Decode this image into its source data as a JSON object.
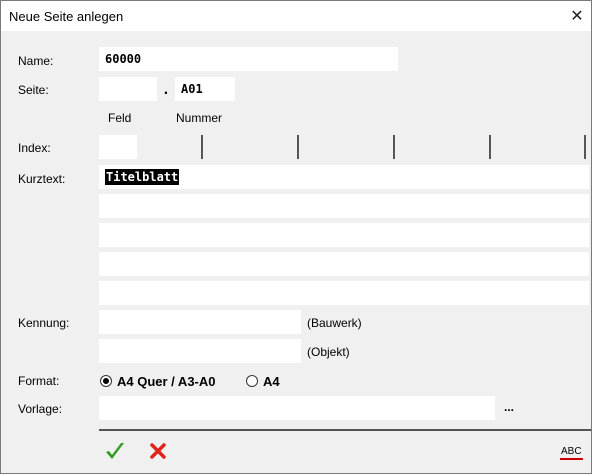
{
  "window": {
    "title": "Neue Seite anlegen",
    "close_glyph": "✕"
  },
  "form": {
    "name_label": "Name:",
    "name_value": "60000",
    "seite_label": "Seite:",
    "seite_feld_value": "",
    "seite_separator": ".",
    "seite_nummer_value": "A01",
    "feld_caption": "Feld",
    "nummer_caption": "Nummer",
    "index_label": "Index:",
    "index_value": "",
    "kurztext_label": "Kurztext:",
    "kurztext_lines": [
      "Titelblatt",
      "",
      "",
      "",
      ""
    ],
    "kennung_label": "Kennung:",
    "kennung_bauwerk_value": "",
    "bauwerk_caption": "(Bauwerk)",
    "kennung_objekt_value": "",
    "objekt_caption": "(Objekt)",
    "format_label": "Format:",
    "format_options": [
      {
        "label": "A4 Quer / A3-A0",
        "checked": true
      },
      {
        "label": "A4",
        "checked": false
      }
    ],
    "vorlage_label": "Vorlage:",
    "vorlage_value": "",
    "browse_label": "..."
  },
  "footer": {
    "ok_icon": "green-checkmark-icon",
    "cancel_icon": "red-x-icon",
    "spellcheck_label": "ABC"
  },
  "colors": {
    "ok": "#2e9e1f",
    "cancel": "#e0241b",
    "spell_underline": "#cc0000"
  }
}
